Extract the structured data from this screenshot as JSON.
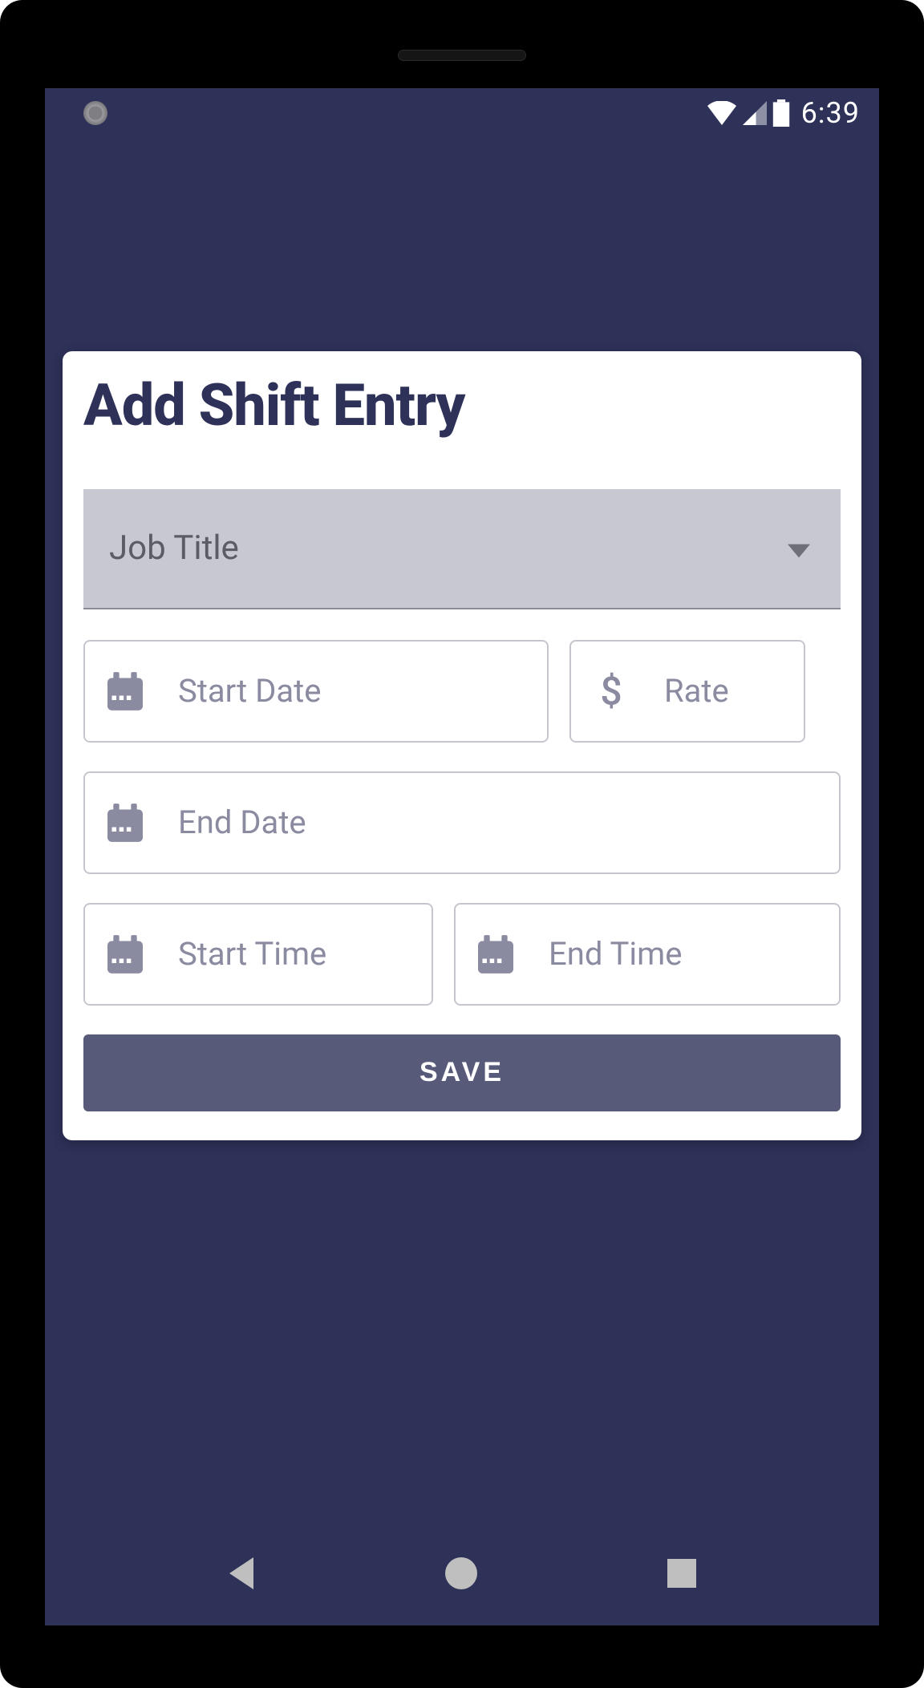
{
  "statusbar": {
    "time": "6:39"
  },
  "card": {
    "title": "Add Shift Entry",
    "dropdown": {
      "label": "Job Title"
    },
    "start_date": {
      "placeholder": "Start Date"
    },
    "rate": {
      "placeholder": "Rate"
    },
    "end_date": {
      "placeholder": "End Date"
    },
    "start_time": {
      "placeholder": "Start Time"
    },
    "end_time": {
      "placeholder": "End Time"
    },
    "save_label": "SAVE"
  }
}
